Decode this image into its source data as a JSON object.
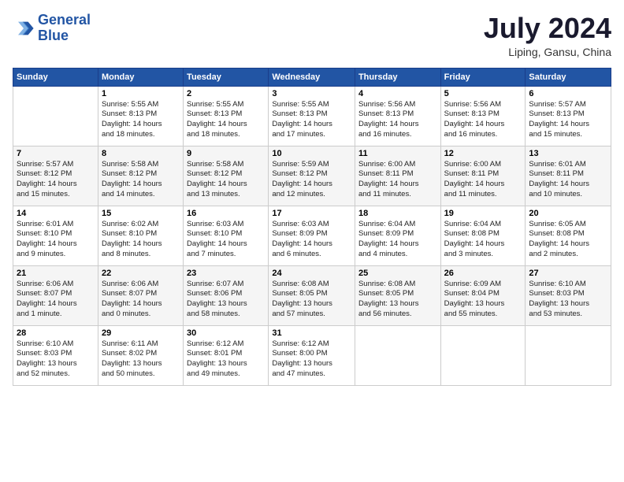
{
  "header": {
    "logo_line1": "General",
    "logo_line2": "Blue",
    "month_year": "July 2024",
    "location": "Liping, Gansu, China"
  },
  "weekdays": [
    "Sunday",
    "Monday",
    "Tuesday",
    "Wednesday",
    "Thursday",
    "Friday",
    "Saturday"
  ],
  "weeks": [
    [
      {
        "day": "",
        "info": ""
      },
      {
        "day": "1",
        "info": "Sunrise: 5:55 AM\nSunset: 8:13 PM\nDaylight: 14 hours\nand 18 minutes."
      },
      {
        "day": "2",
        "info": "Sunrise: 5:55 AM\nSunset: 8:13 PM\nDaylight: 14 hours\nand 18 minutes."
      },
      {
        "day": "3",
        "info": "Sunrise: 5:55 AM\nSunset: 8:13 PM\nDaylight: 14 hours\nand 17 minutes."
      },
      {
        "day": "4",
        "info": "Sunrise: 5:56 AM\nSunset: 8:13 PM\nDaylight: 14 hours\nand 16 minutes."
      },
      {
        "day": "5",
        "info": "Sunrise: 5:56 AM\nSunset: 8:13 PM\nDaylight: 14 hours\nand 16 minutes."
      },
      {
        "day": "6",
        "info": "Sunrise: 5:57 AM\nSunset: 8:13 PM\nDaylight: 14 hours\nand 15 minutes."
      }
    ],
    [
      {
        "day": "7",
        "info": "Sunrise: 5:57 AM\nSunset: 8:12 PM\nDaylight: 14 hours\nand 15 minutes."
      },
      {
        "day": "8",
        "info": "Sunrise: 5:58 AM\nSunset: 8:12 PM\nDaylight: 14 hours\nand 14 minutes."
      },
      {
        "day": "9",
        "info": "Sunrise: 5:58 AM\nSunset: 8:12 PM\nDaylight: 14 hours\nand 13 minutes."
      },
      {
        "day": "10",
        "info": "Sunrise: 5:59 AM\nSunset: 8:12 PM\nDaylight: 14 hours\nand 12 minutes."
      },
      {
        "day": "11",
        "info": "Sunrise: 6:00 AM\nSunset: 8:11 PM\nDaylight: 14 hours\nand 11 minutes."
      },
      {
        "day": "12",
        "info": "Sunrise: 6:00 AM\nSunset: 8:11 PM\nDaylight: 14 hours\nand 11 minutes."
      },
      {
        "day": "13",
        "info": "Sunrise: 6:01 AM\nSunset: 8:11 PM\nDaylight: 14 hours\nand 10 minutes."
      }
    ],
    [
      {
        "day": "14",
        "info": "Sunrise: 6:01 AM\nSunset: 8:10 PM\nDaylight: 14 hours\nand 9 minutes."
      },
      {
        "day": "15",
        "info": "Sunrise: 6:02 AM\nSunset: 8:10 PM\nDaylight: 14 hours\nand 8 minutes."
      },
      {
        "day": "16",
        "info": "Sunrise: 6:03 AM\nSunset: 8:10 PM\nDaylight: 14 hours\nand 7 minutes."
      },
      {
        "day": "17",
        "info": "Sunrise: 6:03 AM\nSunset: 8:09 PM\nDaylight: 14 hours\nand 6 minutes."
      },
      {
        "day": "18",
        "info": "Sunrise: 6:04 AM\nSunset: 8:09 PM\nDaylight: 14 hours\nand 4 minutes."
      },
      {
        "day": "19",
        "info": "Sunrise: 6:04 AM\nSunset: 8:08 PM\nDaylight: 14 hours\nand 3 minutes."
      },
      {
        "day": "20",
        "info": "Sunrise: 6:05 AM\nSunset: 8:08 PM\nDaylight: 14 hours\nand 2 minutes."
      }
    ],
    [
      {
        "day": "21",
        "info": "Sunrise: 6:06 AM\nSunset: 8:07 PM\nDaylight: 14 hours\nand 1 minute."
      },
      {
        "day": "22",
        "info": "Sunrise: 6:06 AM\nSunset: 8:07 PM\nDaylight: 14 hours\nand 0 minutes."
      },
      {
        "day": "23",
        "info": "Sunrise: 6:07 AM\nSunset: 8:06 PM\nDaylight: 13 hours\nand 58 minutes."
      },
      {
        "day": "24",
        "info": "Sunrise: 6:08 AM\nSunset: 8:05 PM\nDaylight: 13 hours\nand 57 minutes."
      },
      {
        "day": "25",
        "info": "Sunrise: 6:08 AM\nSunset: 8:05 PM\nDaylight: 13 hours\nand 56 minutes."
      },
      {
        "day": "26",
        "info": "Sunrise: 6:09 AM\nSunset: 8:04 PM\nDaylight: 13 hours\nand 55 minutes."
      },
      {
        "day": "27",
        "info": "Sunrise: 6:10 AM\nSunset: 8:03 PM\nDaylight: 13 hours\nand 53 minutes."
      }
    ],
    [
      {
        "day": "28",
        "info": "Sunrise: 6:10 AM\nSunset: 8:03 PM\nDaylight: 13 hours\nand 52 minutes."
      },
      {
        "day": "29",
        "info": "Sunrise: 6:11 AM\nSunset: 8:02 PM\nDaylight: 13 hours\nand 50 minutes."
      },
      {
        "day": "30",
        "info": "Sunrise: 6:12 AM\nSunset: 8:01 PM\nDaylight: 13 hours\nand 49 minutes."
      },
      {
        "day": "31",
        "info": "Sunrise: 6:12 AM\nSunset: 8:00 PM\nDaylight: 13 hours\nand 47 minutes."
      },
      {
        "day": "",
        "info": ""
      },
      {
        "day": "",
        "info": ""
      },
      {
        "day": "",
        "info": ""
      }
    ]
  ]
}
